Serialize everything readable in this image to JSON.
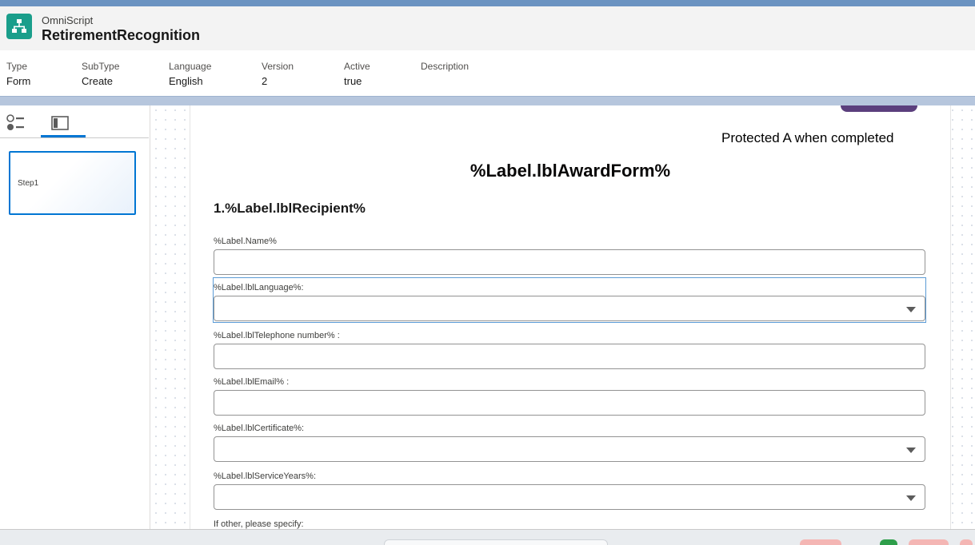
{
  "app": {
    "kicker": "OmniScript",
    "title": "RetirementRecognition",
    "icon": "hierarchy-icon",
    "accent": "#1a9e8b"
  },
  "meta": [
    {
      "label": "Type",
      "value": "Form"
    },
    {
      "label": "SubType",
      "value": "Create"
    },
    {
      "label": "Language",
      "value": "English"
    },
    {
      "label": "Version",
      "value": "2"
    },
    {
      "label": "Active",
      "value": "true"
    },
    {
      "label": "Description",
      "value": ""
    }
  ],
  "panel": {
    "tabs": [
      {
        "name": "list-view-icon",
        "active": false
      },
      {
        "name": "layout-panel-icon",
        "active": true
      }
    ],
    "steps": [
      {
        "label": "Step1"
      }
    ]
  },
  "form": {
    "protected_note": "Protected A when completed",
    "title": "%Label.lblAwardForm%",
    "section": "1.%Label.lblRecipient%",
    "fields": [
      {
        "label": "%Label.Name%",
        "type": "text",
        "value": ""
      },
      {
        "label": "%Label.lblLanguage%:",
        "type": "select",
        "value": ""
      },
      {
        "label": "%Label.lblTelephone number% :",
        "type": "text",
        "value": ""
      },
      {
        "label": "%Label.lblEmail% :",
        "type": "text",
        "value": ""
      },
      {
        "label": "%Label.lblCertificate%:",
        "type": "select",
        "value": ""
      },
      {
        "label": "%Label.lblServiceYears%:",
        "type": "select",
        "value": ""
      }
    ],
    "trailing_label": "If other, please specify:"
  }
}
